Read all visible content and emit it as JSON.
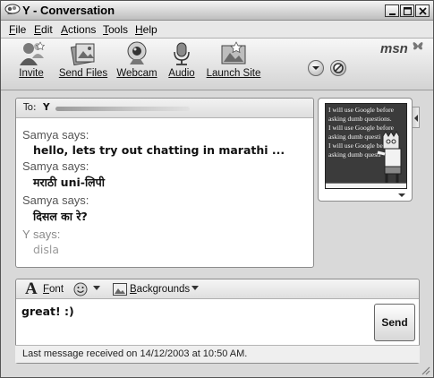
{
  "window": {
    "title": "Y - Conversation",
    "colors": {
      "titlebar": "#c8c8c8",
      "panel": "#ffffff",
      "chrome": "#d9d9d9"
    }
  },
  "menu": [
    "File",
    "Edit",
    "Actions",
    "Tools",
    "Help"
  ],
  "toolbar": {
    "items": [
      {
        "label": "Invite",
        "icon": "invite-people-icon"
      },
      {
        "label": "Send Files",
        "icon": "send-files-icon"
      },
      {
        "label": "Webcam",
        "icon": "webcam-icon"
      },
      {
        "label": "Audio",
        "icon": "microphone-icon"
      },
      {
        "label": "Launch Site",
        "icon": "launch-site-icon"
      }
    ],
    "logo": "msn"
  },
  "conversation": {
    "to_label": "To:",
    "to_name": "Y",
    "messages": [
      {
        "sender": "Samya says:",
        "text": "hello, lets try out chatting in marathi ..."
      },
      {
        "sender": "Samya says:",
        "text": "मराठी uni-लिपी"
      },
      {
        "sender": "Samya says:",
        "text": "दिसल का रे?"
      },
      {
        "sender": "Y says:",
        "text": "disla"
      }
    ]
  },
  "display_picture": {
    "board_lines": [
      "I will use Google before",
      "asking dumb questions.",
      "I will use Google before",
      "asking dumb questi",
      "I will use Google be",
      "asking dumb questi"
    ]
  },
  "format_bar": {
    "font_label": "Font",
    "backgrounds_label": "Backgrounds"
  },
  "compose": {
    "text": "great! :)",
    "send_label": "Send"
  },
  "status": {
    "text": "Last message received on 14/12/2003 at 10:50 AM."
  }
}
